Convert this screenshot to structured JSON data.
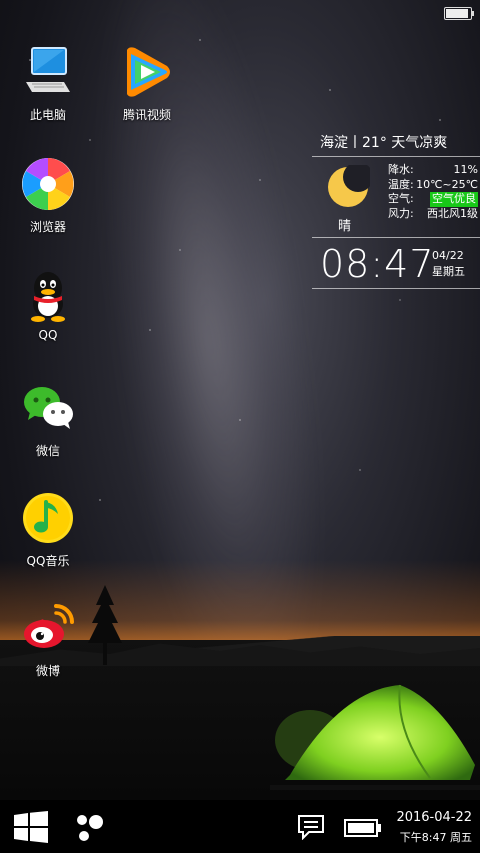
{
  "desktop": {
    "icons": [
      {
        "label": "此电脑",
        "icon": "computer-icon"
      },
      {
        "label": "腾讯视频",
        "icon": "tencent-video-icon"
      },
      {
        "label": "浏览器",
        "icon": "browser-icon"
      },
      {
        "label": "QQ",
        "icon": "qq-icon"
      },
      {
        "label": "微信",
        "icon": "wechat-icon"
      },
      {
        "label": "QQ音乐",
        "icon": "qq-music-icon"
      },
      {
        "label": "微博",
        "icon": "weibo-icon"
      }
    ]
  },
  "weather": {
    "header": "海淀丨21°  天气凉爽",
    "condition": "晴",
    "rows": [
      {
        "label": "降水:",
        "value": "11%"
      },
      {
        "label": "温度:",
        "value": "10℃~25℃"
      },
      {
        "label": "空气:",
        "value": "空气优良"
      },
      {
        "label": "风力:",
        "value": "西北风1级"
      }
    ],
    "time": "08:47",
    "date": "04/22",
    "weekday": "星期五",
    "aq_color": "#18c818"
  },
  "taskbar": {
    "date": "2016-04-22",
    "time": "下午8:47 周五",
    "icons": [
      "windows-start-icon",
      "apps-dots-icon",
      "notification-icon",
      "battery-icon"
    ]
  },
  "statusbar": {
    "battery_level": 0.9
  }
}
